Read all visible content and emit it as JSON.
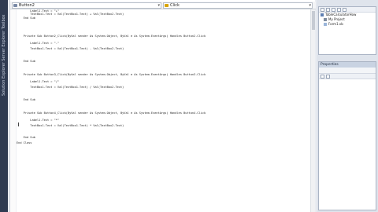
{
  "left_strip": {
    "label": "Solution Explorer  Server Explorer  Toolbox"
  },
  "editor": {
    "object_dropdown": "Button2",
    "event_dropdown": "Click",
    "lines": [
      {
        "text": "        Label1.Text = \"+\""
      },
      {
        "text": "        TextBox1.Text = Val(TextBox1.Text) + Val(TextBox2.Text)"
      },
      {
        "text": "    End Sub"
      },
      {
        "text": ""
      },
      {
        "text": "    Private Sub Button2_Click(ByVal sender As System.Object, ByVal e As System.EventArgs) Handles Button2.Click"
      },
      {
        "text": "        Label1.Text = \"-\""
      },
      {
        "text": "        TextBox1.Text = Val(TextBox1.Text) - Val(TextBox2.Text)"
      },
      {
        "text": "    End Sub"
      },
      {
        "text": ""
      },
      {
        "text": "    Private Sub Button3_Click(ByVal sender As System.Object, ByVal e As System.EventArgs) Handles Button3.Click"
      },
      {
        "text": "        Label1.Text = \"/\""
      },
      {
        "text": "        TextBox1.Text = Val(TextBox1.Text) / Val(TextBox2.Text)"
      },
      {
        "text": "    End Sub"
      },
      {
        "text": ""
      },
      {
        "text": "    Private Sub Button4_Click(ByVal sender As System.Object, ByVal e As System.EventArgs) Handles Button4.Click"
      },
      {
        "text": "        Label1.Text = \"*\""
      },
      {
        "text": "        TextBox1.Text = Val(TextBox1.Text) * Val(TextBox2.Text)"
      },
      {
        "text": ""
      },
      {
        "text": "    End Sub"
      },
      {
        "text": "End Class"
      }
    ]
  },
  "solution_explorer": {
    "items": [
      {
        "label": "TableCalculatorHow"
      },
      {
        "label": "My Project"
      },
      {
        "label": "Form1.vb"
      }
    ]
  },
  "properties": {
    "title": "Properties"
  },
  "colors": {
    "keyword": "#1f3fb5",
    "type": "#2b91af",
    "string": "#a31515",
    "strip": "#2f3b52"
  }
}
